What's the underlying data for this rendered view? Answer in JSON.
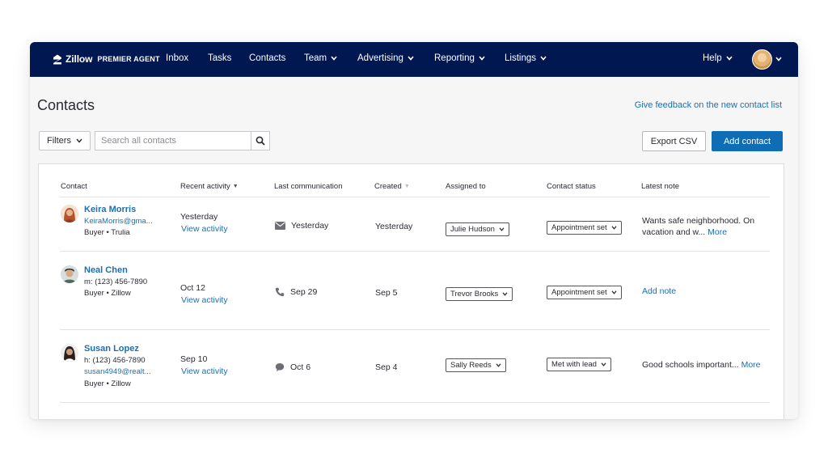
{
  "nav": {
    "brand_name": "Zillow",
    "brand_sub": "PREMIER AGENT",
    "items": [
      {
        "label": "Inbox"
      },
      {
        "label": "Tasks"
      },
      {
        "label": "Contacts"
      },
      {
        "label": "Team"
      },
      {
        "label": "Advertising"
      },
      {
        "label": "Reporting"
      },
      {
        "label": "Listings"
      }
    ],
    "help": "Help",
    "bg_color": "#001751"
  },
  "page": {
    "title": "Contacts",
    "feedback": "Give feedback on the new contact list"
  },
  "toolbar": {
    "filters": "Filters",
    "search_placeholder": "Search all contacts",
    "export": "Export CSV",
    "add": "Add contact",
    "accent": "#0e6db5"
  },
  "table": {
    "headers": [
      "Contact",
      "Recent activity",
      "Last communication",
      "Created",
      "Assigned to",
      "Contact status",
      "Latest note"
    ],
    "rows": [
      {
        "name": "Keira Morris",
        "line2": "KeiraMorris@gma...",
        "line3": "Buyer • Trulia",
        "recent": "Yesterday",
        "recent_link": "View activity",
        "comm_icon": "mail-icon",
        "comm": "Yesterday",
        "created": "Yesterday",
        "assigned": "Julie Hudson",
        "status": "Appointment set",
        "note": "Wants safe neighborhood. On vacation and w...",
        "note_link": "More"
      },
      {
        "name": "Neal Chen",
        "line2": "m: (123) 456-7890",
        "line3": "Buyer • Zillow",
        "recent": "Oct 12",
        "recent_link": "View activity",
        "comm_icon": "phone-icon",
        "comm": "Sep 29",
        "created": "Sep 5",
        "assigned": "Trevor Brooks",
        "status": "Appointment set",
        "note": "",
        "note_link": "Add note"
      },
      {
        "name": "Susan Lopez",
        "line2": "h: (123) 456-7890",
        "line2b": "susan4949@realt...",
        "line3": "Buyer • Zillow",
        "recent": "Sep 10",
        "recent_link": "View activity",
        "comm_icon": "chat-bubble-icon",
        "comm": "Oct 6",
        "created": "Sep 4",
        "assigned": "Sally Reeds",
        "status": "Met with lead",
        "note": "Good schools important...",
        "note_link": "More"
      }
    ]
  }
}
